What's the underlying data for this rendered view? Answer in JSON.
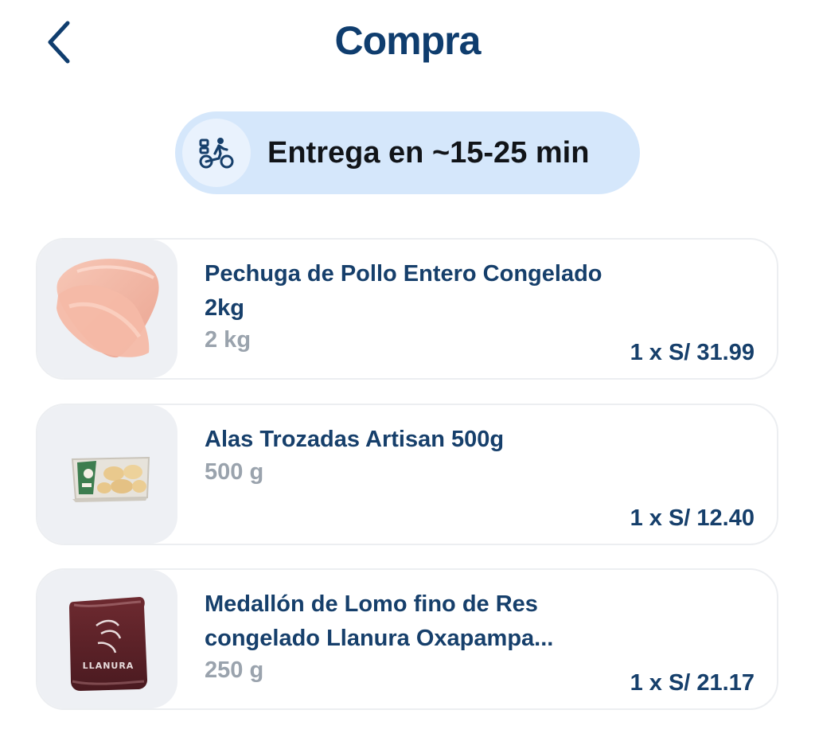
{
  "header": {
    "title": "Compra",
    "back_icon": "chevron-left-icon"
  },
  "delivery": {
    "icon": "delivery-bike-icon",
    "label": "Entrega en ~15-25 min"
  },
  "products": [
    {
      "name": "Pechuga de Pollo Entero Congelado 2kg",
      "size": "2 kg",
      "price": "1 x S/ 31.99",
      "image": "chicken-breast-image"
    },
    {
      "name": "Alas Trozadas Artisan 500g",
      "size": "500 g",
      "price": "1 x S/ 12.40",
      "image": "chicken-wings-package-image"
    },
    {
      "name": "Medallón de Lomo fino de Res congelado Llanura Oxapampa...",
      "size": "250 g",
      "price": "1 x S/ 21.17",
      "image": "beef-tenderloin-package-image",
      "package_text": "LLANURA"
    }
  ],
  "colors": {
    "title": "#0f3d6e",
    "product_text": "#163f6b",
    "muted_text": "#9aa3ad",
    "pill_bg": "#d5e7fb"
  }
}
